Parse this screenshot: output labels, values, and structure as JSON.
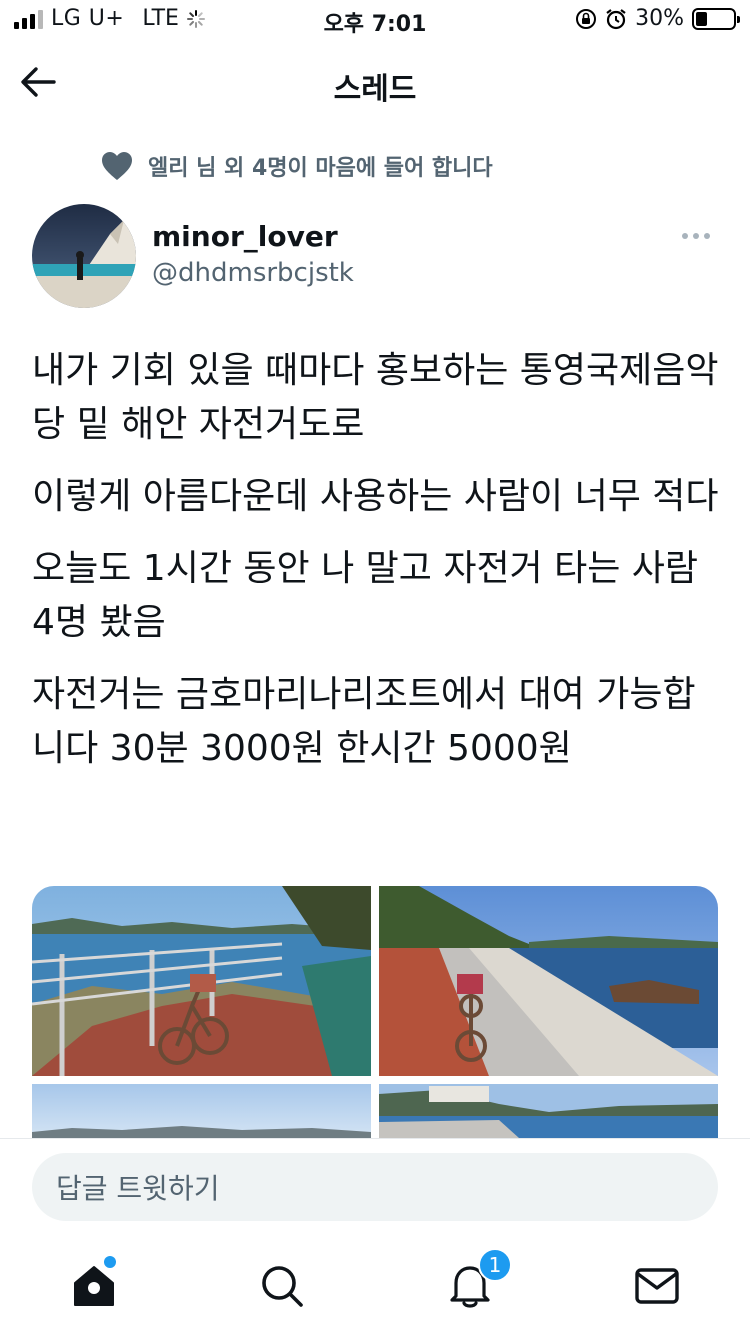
{
  "status_bar": {
    "carrier": "LG U+",
    "network": "LTE",
    "time": "오후 7:01",
    "battery_text": "30%",
    "battery_level": 0.3
  },
  "header": {
    "title": "스레드",
    "back_icon": "arrow-left-icon"
  },
  "social_context": {
    "icon": "heart-icon",
    "text": "엘리 님 외 4명이 마음에 들어 합니다"
  },
  "author": {
    "display_name": "minor_lover",
    "handle": "@dhdmsrbcjstk"
  },
  "tweet": {
    "paragraphs": [
      "내가 기회 있을 때마다 홍보하는 통영국제음악당 밑 해안 자전거도로",
      "이렇게 아름다운데 사용하는 사람이 너무 적다",
      "오늘도 1시간 동안 나 말고 자전거 타는 사람 4명 봤음",
      "자전거는 금호마리나리조트에서 대여 가능합니다 30분 3000원 한시간 5000원"
    ]
  },
  "reply": {
    "placeholder": "답글 트윗하기"
  },
  "tab_bar": {
    "tabs": [
      {
        "name": "home",
        "icon": "home-icon"
      },
      {
        "name": "search",
        "icon": "search-icon"
      },
      {
        "name": "notifications",
        "icon": "bell-icon"
      },
      {
        "name": "messages",
        "icon": "mail-icon"
      }
    ],
    "notification_count": "1"
  },
  "colors": {
    "accent": "#1d9bf0",
    "secondary_text": "#536471"
  }
}
